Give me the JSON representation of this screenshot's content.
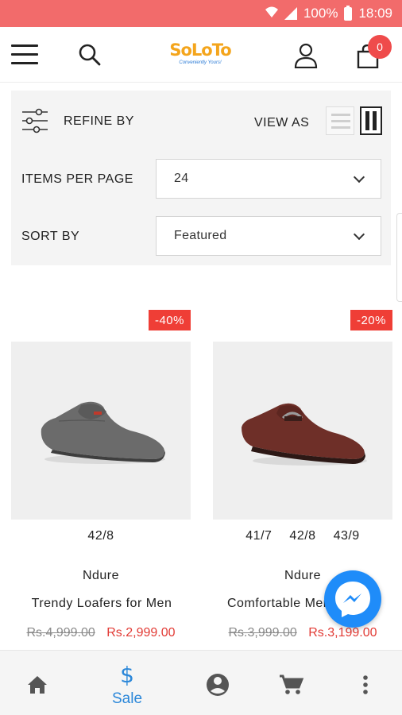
{
  "status_bar": {
    "battery": "100%",
    "time": "18:09"
  },
  "header": {
    "logo": "SoLoTo",
    "logo_tagline": "Conveniently Yours!",
    "cart_count": "0"
  },
  "filters": {
    "refine_label": "REFINE BY",
    "view_as_label": "VIEW AS",
    "items_per_page_label": "ITEMS PER PAGE",
    "items_per_page_value": "24",
    "sort_by_label": "SORT BY",
    "sort_by_value": "Featured"
  },
  "products": [
    {
      "discount": "-40%",
      "sizes": [
        "42/8"
      ],
      "brand": "Ndure",
      "name": "Trendy Loafers for Men",
      "old_price": "Rs.4,999.00",
      "new_price": "Rs.2,999.00",
      "image": "grey-loafer"
    },
    {
      "discount": "-20%",
      "sizes": [
        "41/7",
        "42/8",
        "43/9"
      ],
      "brand": "Ndure",
      "name": "Comfortable Men Loafers",
      "old_price": "Rs.3,999.00",
      "new_price": "Rs.3,199.00",
      "image": "brown-loafer"
    }
  ],
  "bottom_nav": {
    "items": [
      {
        "icon": "home-icon"
      },
      {
        "icon": "dollar-icon",
        "label": "Sale"
      },
      {
        "icon": "account-icon"
      },
      {
        "icon": "cart-icon"
      },
      {
        "icon": "more-vert-icon"
      }
    ]
  },
  "colors": {
    "status_bar": "#f26b6b",
    "accent_red": "#ef3e36",
    "accent_blue": "#2b87d9",
    "messenger_blue": "#1f8cf9"
  }
}
